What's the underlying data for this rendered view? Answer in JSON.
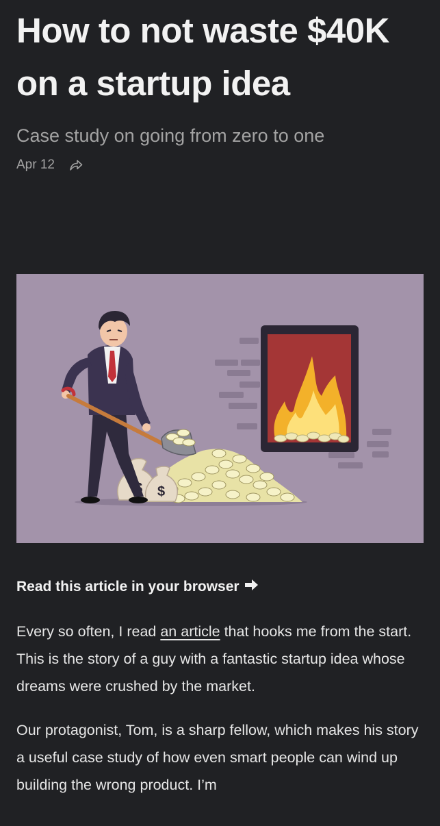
{
  "article": {
    "title": "How to not waste $40K on a startup idea",
    "subtitle": "Case study on going from zero to one",
    "date": "Apr 12",
    "share_icon": "share-arrow-icon",
    "hero_image": "man-shoveling-money-into-fire-illustration",
    "read_in_browser": "Read this article in your browser",
    "read_icon": "arrow-right-icon",
    "p1_before": "Every so often, I read ",
    "p1_link": "an article",
    "p1_after": " that hooks me from the start. This is the story of a guy with a fantastic startup idea whose dreams were crushed by the market.",
    "p2": "Our protagonist, Tom, is a sharp fellow, which makes his story a useful case study of how even smart people can wind up building the wrong product. I’m"
  },
  "colors": {
    "background": "#202124",
    "hero_background": "#a393aa",
    "fire_box": "#a43636"
  }
}
